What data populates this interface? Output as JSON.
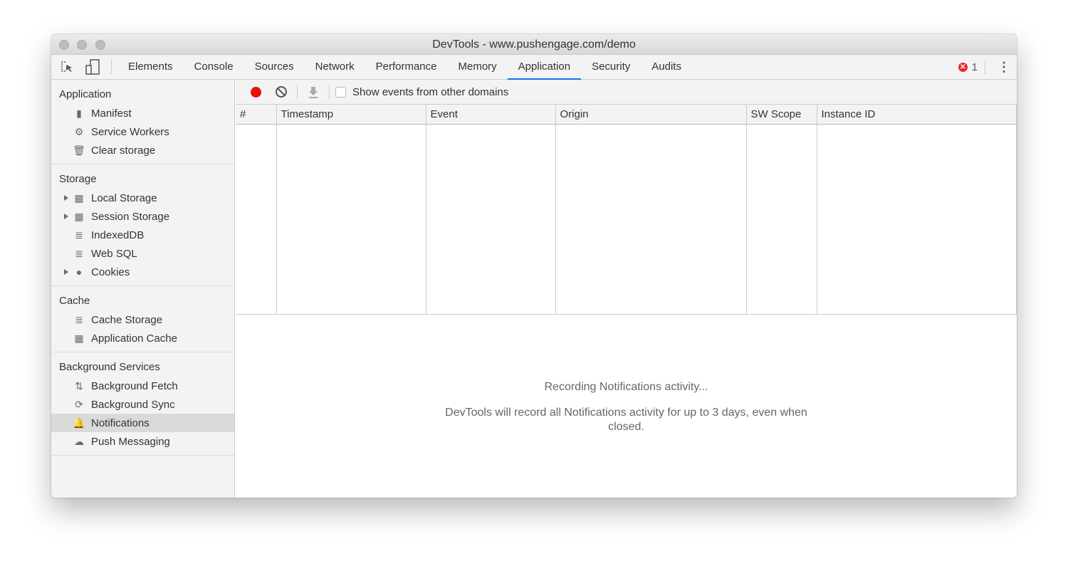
{
  "window": {
    "title": "DevTools - www.pushengage.com/demo"
  },
  "tabs": [
    "Elements",
    "Console",
    "Sources",
    "Network",
    "Performance",
    "Memory",
    "Application",
    "Security",
    "Audits"
  ],
  "active_tab": "Application",
  "error_count": "1",
  "sidebar": {
    "application": {
      "title": "Application",
      "items": [
        "Manifest",
        "Service Workers",
        "Clear storage"
      ]
    },
    "storage": {
      "title": "Storage",
      "items": [
        "Local Storage",
        "Session Storage",
        "IndexedDB",
        "Web SQL",
        "Cookies"
      ]
    },
    "cache": {
      "title": "Cache",
      "items": [
        "Cache Storage",
        "Application Cache"
      ]
    },
    "background": {
      "title": "Background Services",
      "items": [
        "Background Fetch",
        "Background Sync",
        "Notifications",
        "Push Messaging"
      ]
    }
  },
  "toolbar": {
    "checkbox_label": "Show events from other domains",
    "record_color": "#e51400"
  },
  "table": {
    "columns": [
      "#",
      "Timestamp",
      "Event",
      "Origin",
      "SW Scope",
      "Instance ID"
    ]
  },
  "empty": {
    "title": "Recording Notifications activity...",
    "body": "DevTools will record all Notifications activity for up to 3 days, even when closed."
  }
}
